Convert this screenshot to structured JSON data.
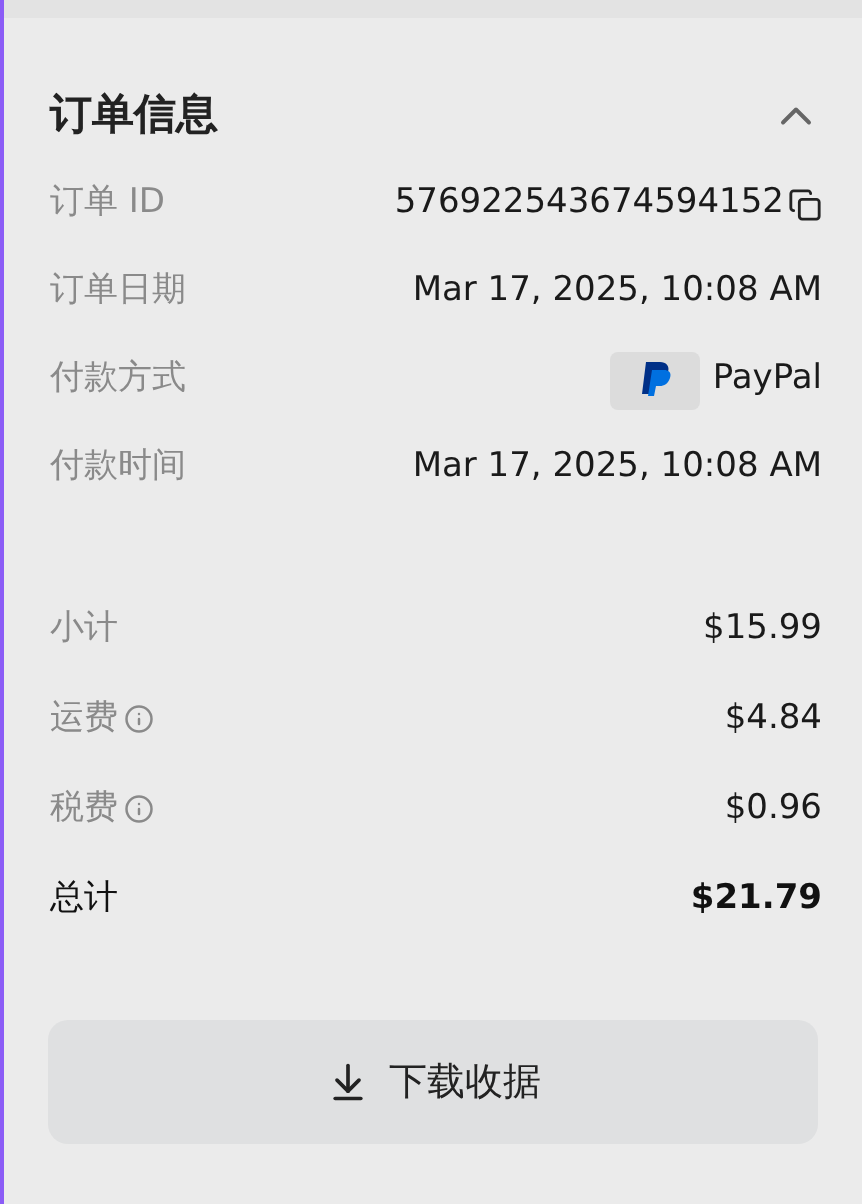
{
  "section": {
    "title": "订单信息",
    "expanded": true
  },
  "details": [
    {
      "kind": "copy",
      "label": "订单 ID",
      "value": "576922543674594152"
    },
    {
      "kind": "text",
      "label": "订单日期",
      "value": "Mar 17, 2025, 10:08 AM"
    },
    {
      "kind": "payment",
      "label": "付款方式",
      "value": "PayPal"
    },
    {
      "kind": "text",
      "label": "付款时间",
      "value": "Mar 17, 2025, 10:08 AM"
    }
  ],
  "summary": [
    {
      "kind": "line",
      "label": "小计",
      "value": "$15.99",
      "info": false
    },
    {
      "kind": "line",
      "label": "运费",
      "value": "$4.84",
      "info": true
    },
    {
      "kind": "line",
      "label": "税费",
      "value": "$0.96",
      "info": true
    },
    {
      "kind": "total",
      "label": "总计",
      "value": "$21.79",
      "info": false
    }
  ],
  "download_button": "下载收据"
}
